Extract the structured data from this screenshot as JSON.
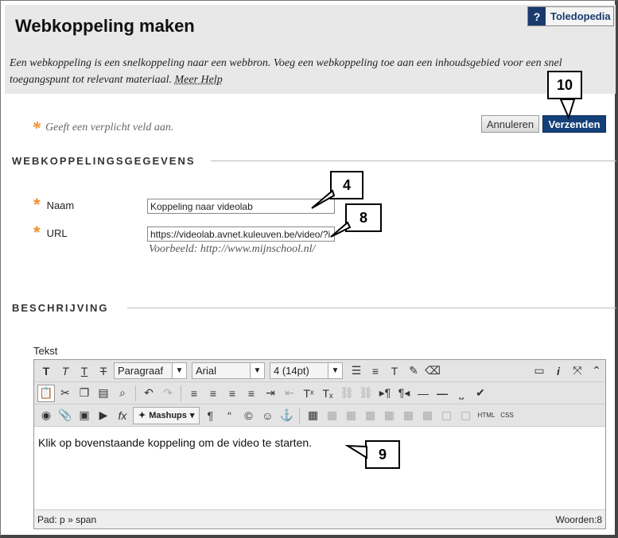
{
  "header": {
    "title": "Webkoppeling maken",
    "intro": "Een webkoppeling is een snelkoppeling naar een webbron. Voeg een webkoppeling toe aan een inhoudsgebied voor een snel toegangspunt tot relevant materiaal.",
    "help_link": "Meer Help",
    "toledo_q": "?",
    "toledo_label": "Toledopedia"
  },
  "form": {
    "required_note": "Geeft een verplicht veld aan.",
    "cancel_label": "Annuleren",
    "submit_label": "Verzenden",
    "section1": "WEBKOPPELINGSGEGEVENS",
    "name_label": "Naam",
    "name_value": "Koppeling naar videolab",
    "url_label": "URL",
    "url_value": "https://videolab.avnet.kuleuven.be/video/?i",
    "example": "Voorbeeld: http://www.mijnschool.nl/",
    "section2": "BESCHRIJVING",
    "text_label": "Tekst"
  },
  "editor": {
    "paragraph": "Paragraaf",
    "font": "Arial",
    "size": "4 (14pt)",
    "mashups": "Mashups",
    "content": "Klik op bovenstaande koppeling om de video te starten.",
    "path_label": "Pad:",
    "path_p": "p",
    "path_sep": "»",
    "path_span": "span",
    "word_count": "Woorden:8",
    "html_btn": "HTML",
    "css_btn": "CSS"
  },
  "callouts": {
    "c10": "10",
    "c4": "4",
    "c8": "8",
    "c9": "9"
  }
}
